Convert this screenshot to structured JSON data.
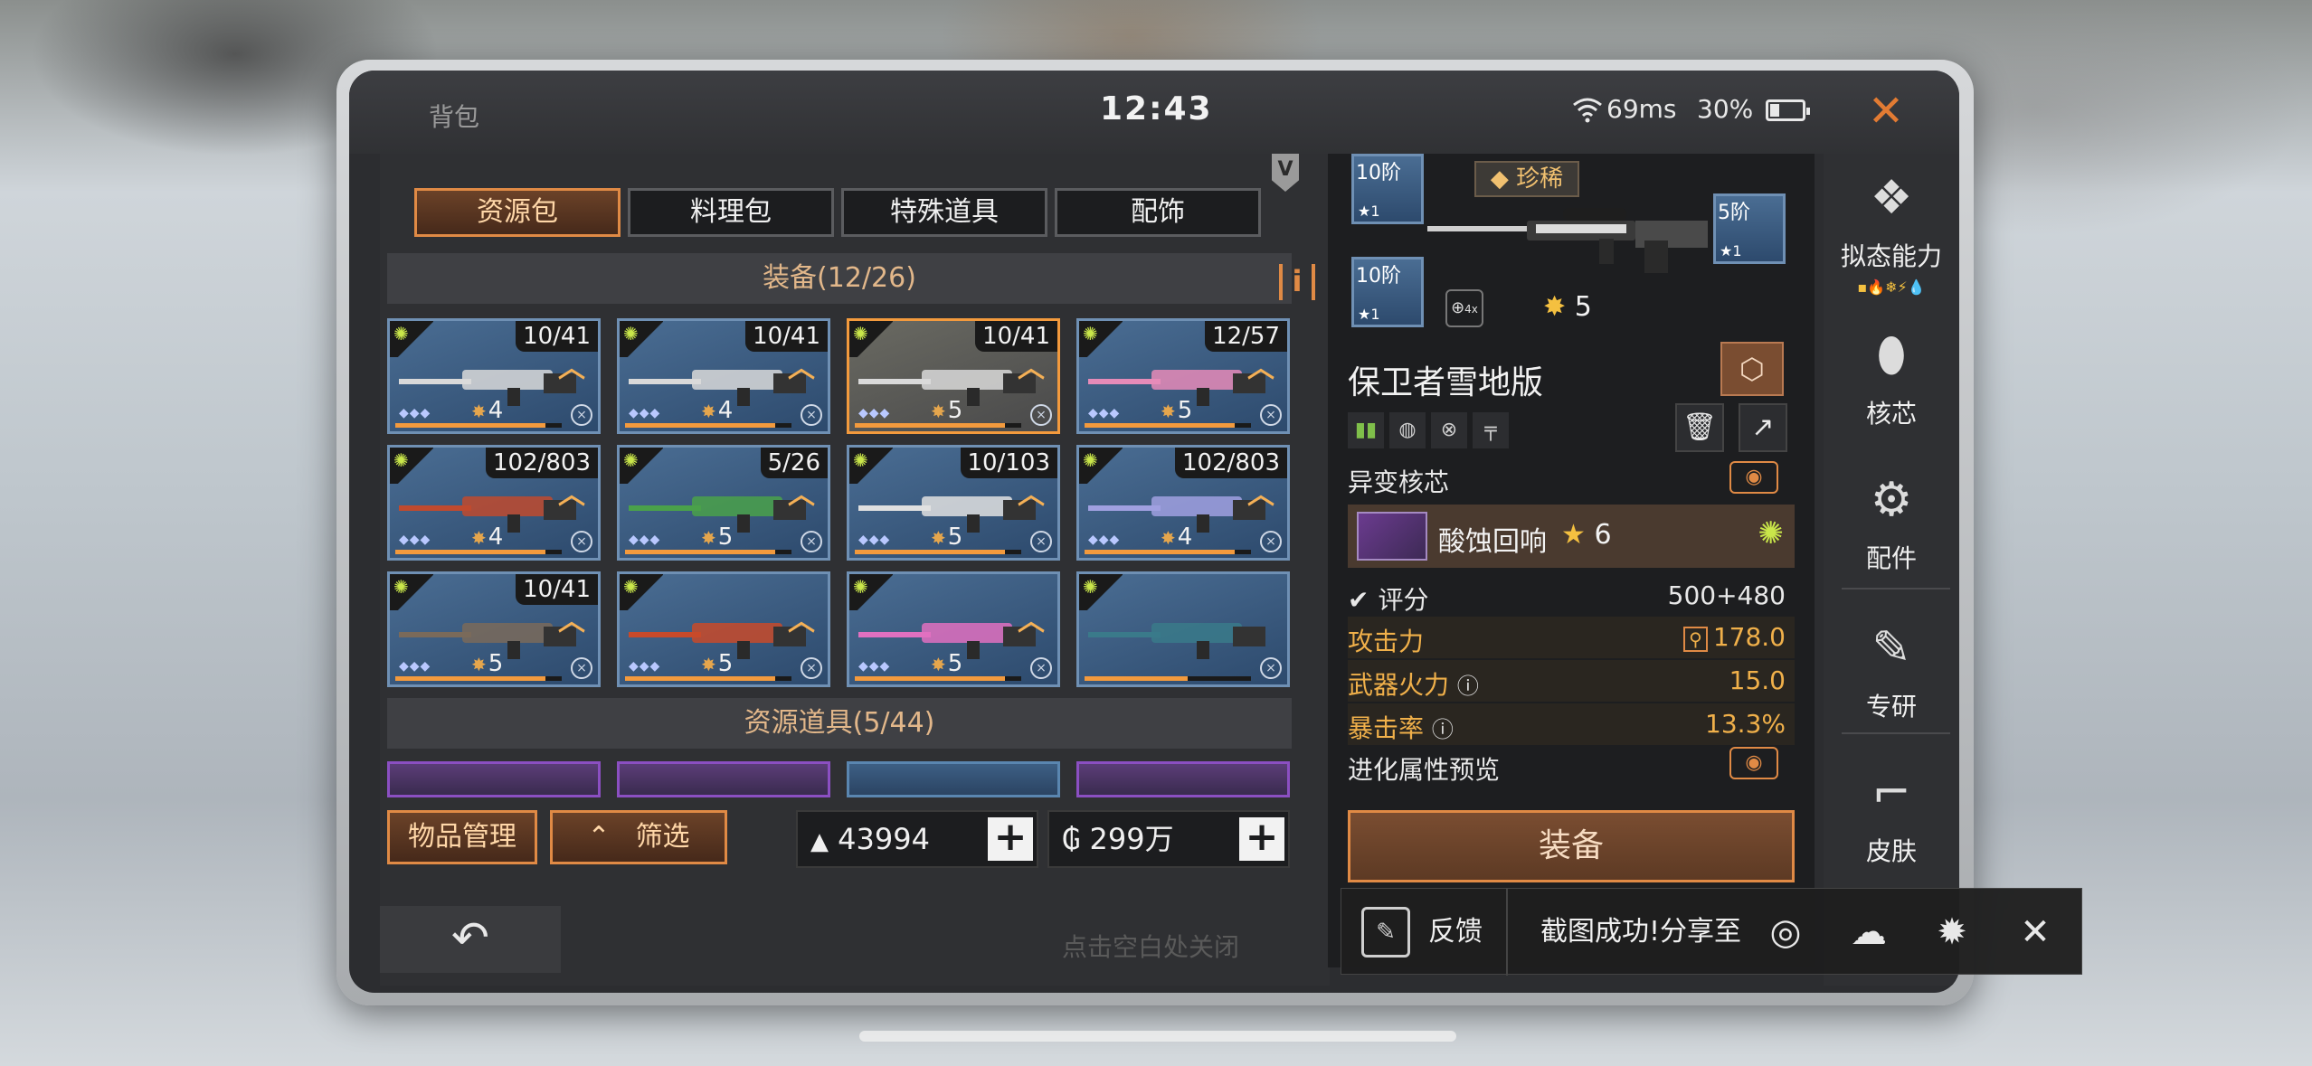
{
  "header": {
    "title": "背包",
    "time": "12:43",
    "ping": "69ms",
    "battery": "30%",
    "battery_level": 0.3
  },
  "tabs": [
    {
      "label": "资源包",
      "selected": true
    },
    {
      "label": "料理包"
    },
    {
      "label": "特殊道具"
    },
    {
      "label": "配饰"
    }
  ],
  "vip_badge": "V",
  "equipment_section": {
    "title": "装备(12/26)",
    "info": "i"
  },
  "equipment": [
    {
      "count": "10/41",
      "level": "4",
      "progress": 0.9
    },
    {
      "count": "10/41",
      "level": "4",
      "progress": 0.9
    },
    {
      "count": "10/41",
      "level": "5",
      "progress": 0.9,
      "selected": true
    },
    {
      "count": "12/57",
      "level": "5",
      "progress": 0.9
    },
    {
      "count": "102/803",
      "level": "4",
      "progress": 0.9
    },
    {
      "count": "5/26",
      "level": "5",
      "progress": 0.9
    },
    {
      "count": "10/103",
      "level": "5",
      "progress": 0.9
    },
    {
      "count": "102/803",
      "level": "4",
      "progress": 0.9
    },
    {
      "count": "10/41",
      "level": "5",
      "progress": 0.9
    },
    {
      "count": "",
      "level": "5",
      "progress": 0.9
    },
    {
      "count": "",
      "level": "5",
      "progress": 0.9
    },
    {
      "count": "",
      "level": "",
      "progress": 0.62
    }
  ],
  "resource_section": {
    "title": "资源道具(5/44)"
  },
  "bottom": {
    "manage": "物品管理",
    "filter": "筛选",
    "currency1": "43994",
    "currency2": "299万",
    "plus": "+"
  },
  "back_hint": "点击空白处关闭",
  "detail": {
    "slots": [
      {
        "tier": "10阶",
        "star": "1"
      },
      {
        "tier": "10阶",
        "star": "1"
      },
      {
        "tier": "5阶",
        "star": "1"
      }
    ],
    "rarity": "珍稀",
    "scope": "4x",
    "weapon_level": "5",
    "weapon_name": "保卫者雪地版",
    "mutation_label": "异变核芯",
    "core": {
      "name": "酸蚀回响",
      "level": "6"
    },
    "score": {
      "label": "评分",
      "value": "500+480"
    },
    "stats": [
      {
        "label": "攻击力",
        "value": "178.0"
      },
      {
        "label": "武器火力",
        "value": "15.0"
      },
      {
        "label": "暴击率",
        "value": "13.3%"
      }
    ],
    "evolution_label": "进化属性预览",
    "equip_button": "装备"
  },
  "sidebar": [
    {
      "label": "拟态能力"
    },
    {
      "label": "核芯"
    },
    {
      "label": "配件"
    },
    {
      "label": "专研"
    },
    {
      "label": "皮肤"
    }
  ],
  "share_toast": {
    "feedback": "反馈",
    "message": "截图成功!分享至"
  },
  "colors": {
    "accent": "#e08a45",
    "card_blue": "#4a6d93",
    "purple": "#8b4fc2"
  }
}
